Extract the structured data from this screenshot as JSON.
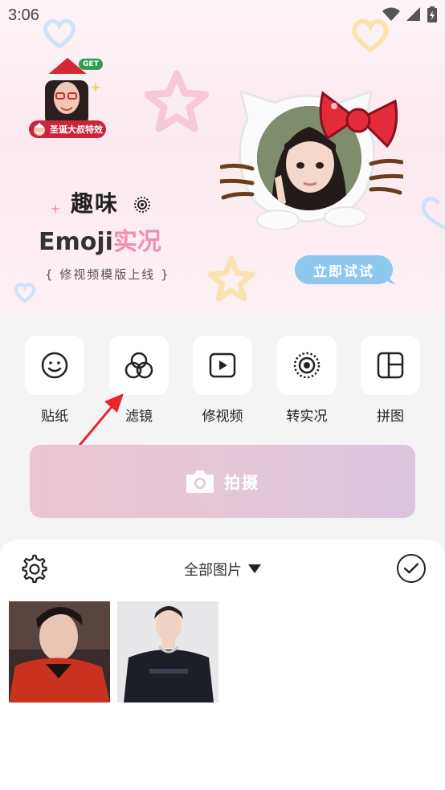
{
  "status_bar": {
    "time": "3:06"
  },
  "banner": {
    "sticker_get": "GET",
    "sticker_label": "圣诞大叔特效",
    "title_line1": "趣味",
    "title_line2_a": "Emoji",
    "title_line2_b": "实况",
    "subtitle": "{ 修视频模版上线 }",
    "try_button": "立即试试"
  },
  "tools": [
    {
      "label": "贴纸",
      "icon": "smiley-icon"
    },
    {
      "label": "滤镜",
      "icon": "filter-circles-icon"
    },
    {
      "label": "修视频",
      "icon": "video-play-icon"
    },
    {
      "label": "转实况",
      "icon": "live-photo-icon"
    },
    {
      "label": "拼图",
      "icon": "collage-icon"
    }
  ],
  "capture": {
    "label": "拍摄",
    "icon": "camera-icon"
  },
  "gallery": {
    "album_label": "全部图片",
    "settings_icon": "gear-icon",
    "select_icon": "check-circle-icon"
  },
  "colors": {
    "accent_pink": "#f08eb5",
    "try_button_blue": "#8ec8ef",
    "annotation_red": "#e8252e"
  }
}
